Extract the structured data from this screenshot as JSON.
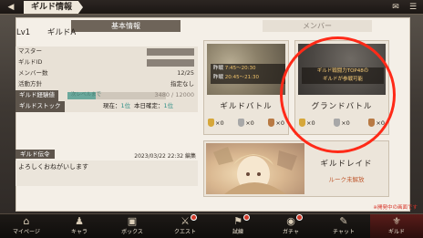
{
  "header": {
    "back_icon": "back-arrow-icon",
    "title": "ギルド情報",
    "icons": [
      "mail-icon",
      "menu-icon"
    ]
  },
  "tabs": [
    {
      "label": "基本情報",
      "active": true
    },
    {
      "label": "メンバー",
      "active": false
    }
  ],
  "guild": {
    "level": "Lv1",
    "name": "ギルドA"
  },
  "info_rows": {
    "master": "マスター",
    "guild_id": "ギルドID",
    "member_count_label": "メンバー数",
    "member_count_value": "12/25",
    "policy_label": "活動方針",
    "policy_value": "指定なし",
    "exp_label": "ギルド経験値",
    "exp_bar_text": "次レベルまで",
    "exp_numbers": "3480 / 12000",
    "exp_fraction": 0.29,
    "stock_label": "ギルドストック",
    "stock_now_label": "現在：",
    "stock_now_value": "1位",
    "stock_today_label": "本日確定：",
    "stock_today_value": "1位"
  },
  "message": {
    "label": "ギルド伝令",
    "date": "2023/03/22 22:32 編集",
    "text": "よろしくおねがいします"
  },
  "guild_battle": {
    "title": "ギルドバトル",
    "row1_label": "昨戦",
    "row1_time": "7:45～20:30",
    "row2_label": "昨戦",
    "row2_time": "20:45～21:30",
    "medals": [
      "×0",
      "×0",
      "×0"
    ]
  },
  "grand_battle": {
    "title": "グランドバトル",
    "note_line1": "ギルド戦闘力TOP48の",
    "note_line2": "ギルドが参戦可能",
    "medals": [
      "×0",
      "×0",
      "×0"
    ]
  },
  "raid": {
    "title": "ギルドレイド",
    "status": "ルーク未解放"
  },
  "dev_note": "※開発中の画面です",
  "nav": [
    {
      "label": "マイページ",
      "icon": "home-icon",
      "badge": false
    },
    {
      "label": "キャラ",
      "icon": "characters-icon",
      "badge": false
    },
    {
      "label": "ボックス",
      "icon": "box-icon",
      "badge": false
    },
    {
      "label": "クエスト",
      "icon": "quest-icon",
      "badge": true
    },
    {
      "label": "試練",
      "icon": "trial-icon",
      "badge": true
    },
    {
      "label": "ガチャ",
      "icon": "gacha-icon",
      "badge": true
    },
    {
      "label": "チャット",
      "icon": "chat-icon",
      "badge": false
    },
    {
      "label": "ギルド",
      "icon": "guild-icon",
      "badge": false
    }
  ],
  "colors": {
    "accent_teal": "#2e8f86",
    "annotation_red": "#ff2a18",
    "badge_red": "#d23a2a"
  }
}
